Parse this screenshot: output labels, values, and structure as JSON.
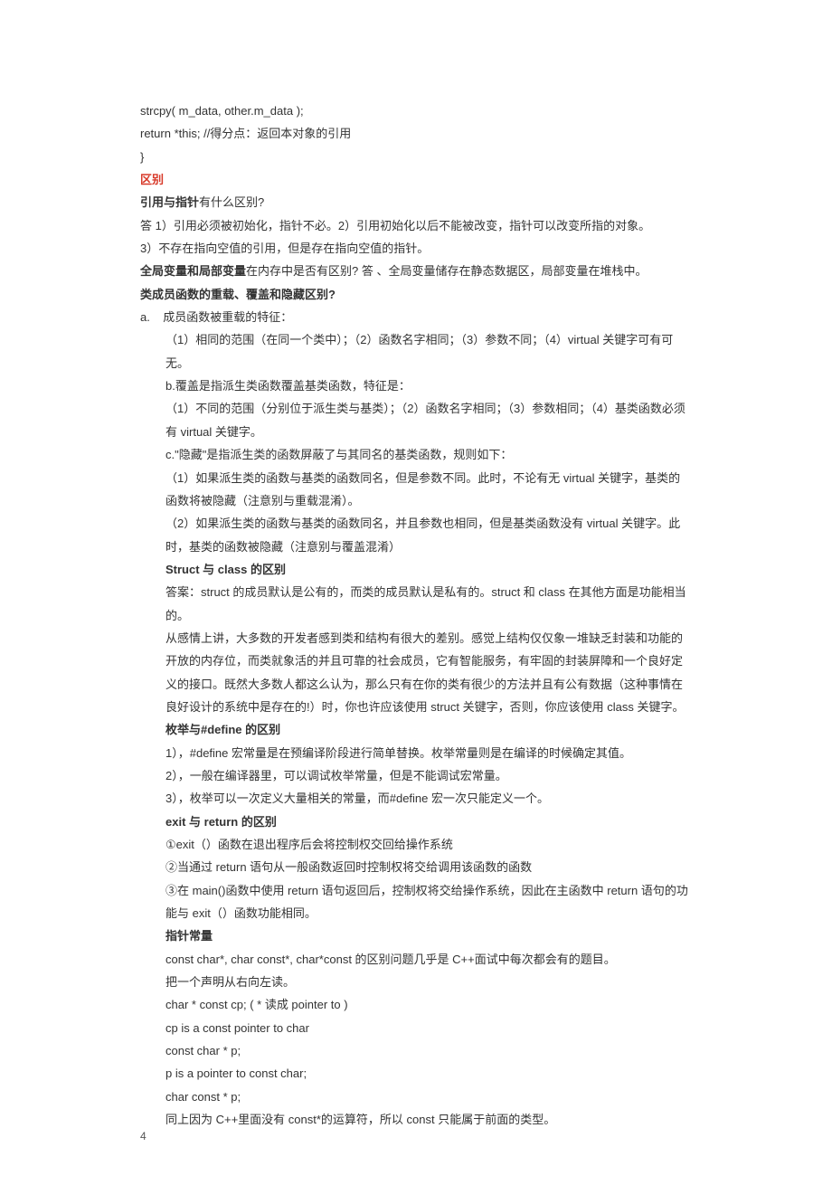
{
  "code1": "strcpy( m_data, other.m_data );",
  "code2": "return *this; //得分点：返回本对象的引用",
  "code3": "}",
  "sec1_title": "区别",
  "l01a": "引用与指针",
  "l01b": "有什么区别?",
  "l02": "答 1）引用必须被初始化，指针不必。2）引用初始化以后不能被改变，指针可以改变所指的对象。",
  "l03": "3）不存在指向空值的引用，但是存在指向空值的指针。",
  "l04a": "全局变量和局部变量",
  "l04b": "在内存中是否有区别? 答 、全局变量储存在静态数据区，局部变量在堆栈中。",
  "l05": "类成员函数的重载、覆盖和隐藏区别?",
  "l06_prefix": "a.",
  "l06": "成员函数被重载的特征：",
  "l07": "（1）相同的范围（在同一个类中）；（2）函数名字相同；（3）参数不同；（4）virtual 关键字可有可无。",
  "l08": "b.覆盖是指派生类函数覆盖基类函数，特征是：",
  "l09": "（1）不同的范围（分别位于派生类与基类）；（2）函数名字相同；（3）参数相同；（4）基类函数必须有 virtual 关键字。",
  "l10": "c.\"隐藏\"是指派生类的函数屏蔽了与其同名的基类函数，规则如下：",
  "l11": "（1）如果派生类的函数与基类的函数同名，但是参数不同。此时，不论有无 virtual 关键字，基类的函数将被隐藏（注意别与重载混淆）。",
  "l12": "（2）如果派生类的函数与基类的函数同名，并且参数也相同，但是基类函数没有 virtual 关键字。此时，基类的函数被隐藏（注意别与覆盖混淆）",
  "gap1": " ",
  "l13a": "Struct",
  "l13b": " 与 ",
  "l13c": "class",
  "l13d": " 的区别",
  "l14": "答案：struct 的成员默认是公有的，而类的成员默认是私有的。struct 和 class 在其他方面是功能相当的。",
  "l15": "从感情上讲，大多数的开发者感到类和结构有很大的差别。感觉上结构仅仅象一堆缺乏封装和功能的开放的内存位，而类就象活的并且可靠的社会成员，它有智能服务，有牢固的封装屏障和一个良好定义的接口。既然大多数人都这么认为，那么只有在你的类有很少的方法并且有公有数据（这种事情在良好设计的系统中是存在的!）时，你也许应该使用 struct 关键字，否则，你应该使用 class 关键字。",
  "l16a": "枚举与",
  "l16b": "#define",
  "l16c": " 的区别",
  "l17": "1），#define 宏常量是在预编译阶段进行简单替换。枚举常量则是在编译的时候确定其值。",
  "l18": "2），一般在编译器里，可以调试枚举常量，但是不能调试宏常量。",
  "l19": "3），枚举可以一次定义大量相关的常量，而#define 宏一次只能定义一个。",
  "l20a": "exit",
  "l20b": " 与 ",
  "l20c": "return",
  "l20d": " 的区别",
  "l21": "①exit（）函数在退出程序后会将控制权交回给操作系统",
  "l22": "②当通过 return 语句从一般函数返回时控制权将交给调用该函数的函数",
  "l23": "③在 main()函数中使用 return 语句返回后，控制权将交给操作系统，因此在主函数中 return 语句的功能与 exit（）函数功能相同。",
  "l24": "指针常量",
  "l25": "const char*, char const*, char*const 的区别问题几乎是 C++面试中每次都会有的题目。",
  "l26": "把一个声明从右向左读。",
  "l27": "char * const cp; ( *  读成  pointer to )",
  "l28": "cp is a const pointer to char",
  "l29": "const char * p;",
  "l30": "p is a pointer to const char;",
  "l31": "char const * p;",
  "l32": "同上因为 C++里面没有 const*的运算符，所以 const 只能属于前面的类型。",
  "page_number": "4"
}
